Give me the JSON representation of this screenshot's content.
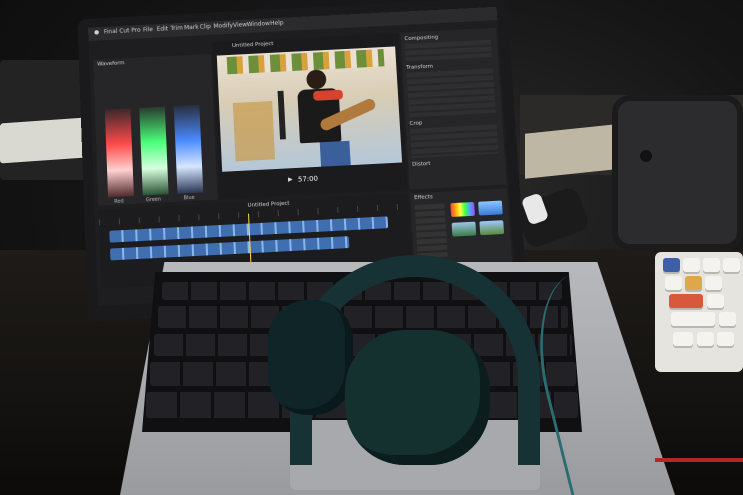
{
  "screen": {
    "menubar": {
      "items": [
        "Final Cut Pro",
        "File",
        "Edit",
        "Trim",
        "Mark",
        "Clip",
        "Modify",
        "View",
        "Window",
        "Help"
      ]
    },
    "scopes": {
      "title": "Waveform",
      "channels": [
        "Red",
        "Green",
        "Blue"
      ]
    },
    "viewer": {
      "title": "Untitled Project",
      "timecode": "57:00"
    },
    "inspector": {
      "sections": [
        "Compositing",
        "Transform",
        "Crop",
        "Distort"
      ]
    },
    "timeline": {
      "title": "Untitled Project"
    },
    "effects": {
      "title": "Effects"
    }
  },
  "colors": {
    "screen_bg": "#1e1e20",
    "headphones": "#173234",
    "accent_blue": "#3f6fb0"
  }
}
